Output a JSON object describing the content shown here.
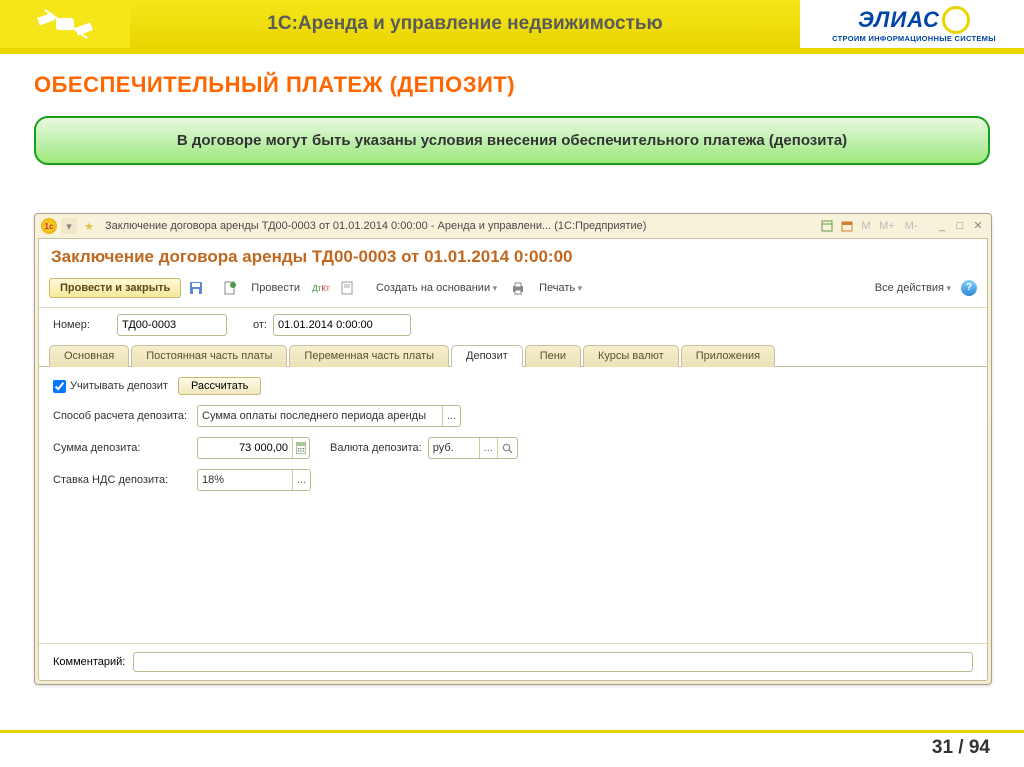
{
  "header": {
    "product_name": "1С:Аренда и управление недвижимостью",
    "company_name": "ЭЛИАС",
    "company_sub": "СТРОИМ ИНФОРМАЦИОННЫЕ СИСТЕМЫ"
  },
  "slide": {
    "title": "ОБЕСПЕЧИТЕЛЬНЫЙ ПЛАТЕЖ (ДЕПОЗИТ)",
    "banner": "В договоре могут быть указаны условия внесения обеспечительного платежа (депозита)",
    "page": "31 / 94"
  },
  "window": {
    "title": "Заключение договора аренды ТД00-0003 от 01.01.2014 0:00:00 - Аренда и управлени... (1С:Предприятие)",
    "mem": {
      "m": "М",
      "mp": "М+",
      "mm": "М-"
    },
    "form_title": "Заключение договора аренды ТД00-0003 от 01.01.2014 0:00:00",
    "toolbar": {
      "submit_close": "Провести и закрыть",
      "submit": "Провести",
      "create_on_basis": "Создать на основании",
      "print": "Печать",
      "all_actions": "Все действия"
    },
    "fields": {
      "number_label": "Номер:",
      "number": "ТД00-0003",
      "date_label": "от:",
      "date": "01.01.2014 0:00:00"
    },
    "tabs": {
      "main": "Основная",
      "const_part": "Постоянная часть платы",
      "var_part": "Переменная часть платы",
      "deposit": "Депозит",
      "penalty": "Пени",
      "rates": "Курсы валют",
      "attachments": "Приложения"
    },
    "deposit": {
      "account_label": "Учитывать депозит",
      "calc_btn": "Рассчитать",
      "method_label": "Способ расчета депозита:",
      "method": "Сумма оплаты последнего периода аренды",
      "sum_label": "Сумма депозита:",
      "sum": "73 000,00",
      "currency_label": "Валюта депозита:",
      "currency": "руб.",
      "vat_label": "Ставка НДС депозита:",
      "vat": "18%"
    },
    "comment_label": "Комментарий:",
    "comment": ""
  }
}
